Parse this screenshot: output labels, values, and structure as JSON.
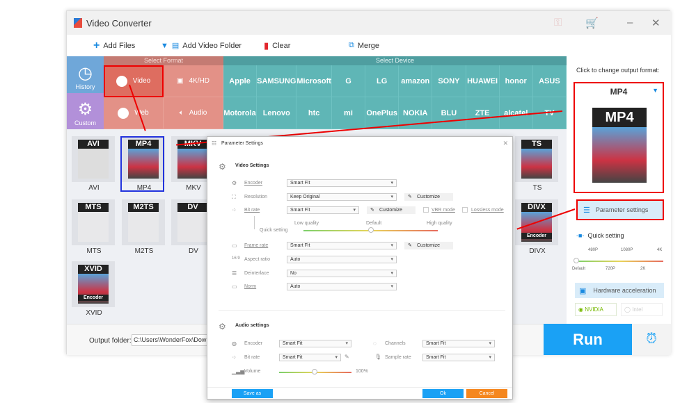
{
  "window": {
    "title": "Video Converter"
  },
  "toolbar": {
    "add_files": "Add Files",
    "add_video_folder": "Add Video Folder",
    "clear": "Clear",
    "merge": "Merge"
  },
  "categories": {
    "history": "History",
    "custom": "Custom",
    "select_format": "Select Format",
    "select_device": "Select Device",
    "formats": [
      "Video",
      "4K/HD",
      "Web",
      "Audio"
    ],
    "devices_row1": [
      "Apple",
      "SAMSUNG",
      "Microsoft",
      "G",
      "LG",
      "amazon",
      "SONY",
      "HUAWEI",
      "honor",
      "ASUS"
    ],
    "devices_row2": [
      "Motorola",
      "Lenovo",
      "htc",
      "mi",
      "OnePlus",
      "NOKIA",
      "BLU",
      "ZTE",
      "alcatel",
      "TV"
    ]
  },
  "format_items": [
    {
      "label": "AVI",
      "badge": "AVI"
    },
    {
      "label": "MP4",
      "badge": "MP4",
      "selected": true
    },
    {
      "label": "MKV",
      "badge": "MKV"
    },
    {
      "label": "MTS",
      "badge": "MTS"
    },
    {
      "label": "M2TS",
      "badge": "M2TS"
    },
    {
      "label": "DV",
      "badge": "DV"
    },
    {
      "label": "XVID",
      "badge": "XVID",
      "sub": "Encoder"
    },
    {
      "label": "TS",
      "badge": "TS"
    },
    {
      "label": "DIVX",
      "badge": "DIVX",
      "sub": "Encoder"
    }
  ],
  "bottom": {
    "output_folder_label": "Output folder:",
    "output_folder_value": "C:\\Users\\WonderFox\\Downlo",
    "run": "Run"
  },
  "right_panel": {
    "hint": "Click to change output format:",
    "format": "MP4",
    "format_badge": "MP4",
    "parameter_settings": "Parameter settings",
    "quick_setting": "Quick setting",
    "quality_top": [
      "480P",
      "1080P",
      "4K"
    ],
    "quality_bottom": [
      "Default",
      "720P",
      "2K"
    ],
    "quality_value": "Default",
    "hardware_acceleration": "Hardware acceleration",
    "nvidia": "NVIDIA",
    "intel": "Intel"
  },
  "dialog": {
    "title": "Parameter Settings",
    "video_settings": "Video Settings",
    "video": {
      "encoder_label": "Encoder",
      "encoder": "Smart Fit",
      "resolution_label": "Resolution",
      "resolution": "Keep Original",
      "bitrate_label": "Bit rate",
      "bitrate": "Smart Fit",
      "customize": "Customize",
      "vbr_mode": "VBR mode",
      "lossless_mode": "Lossless mode",
      "quick_setting": "Quick setting",
      "low_quality": "Low quality",
      "default": "Default",
      "high_quality": "High quality",
      "quick_setting_value": "Default",
      "frame_rate_label": "Frame rate",
      "frame_rate": "Smart Fit",
      "aspect_ratio_label": "Aspect ratio",
      "aspect_ratio": "Auto",
      "deinterlace_label": "Deinterlace",
      "deinterlace": "No",
      "norm_label": "Norm",
      "norm": "Auto"
    },
    "audio_settings": "Audio settings",
    "audio": {
      "encoder_label": "Encoder",
      "encoder": "Smart Fit",
      "channels_label": "Channels",
      "channels": "Smart Fit",
      "bitrate_label": "Bit rate",
      "bitrate": "Smart Fit",
      "sample_rate_label": "Sample rate",
      "sample_rate": "Smart Fit",
      "volume_label": "Volume",
      "volume": "100%"
    },
    "save_as": "Save as",
    "ok": "Ok",
    "cancel": "Cancel"
  },
  "colors": {
    "accent": "#1aa1f5",
    "format_red": "#e39187",
    "device_teal": "#5fb6b6",
    "cancel": "#f5871f",
    "highlight": "#e00000"
  }
}
